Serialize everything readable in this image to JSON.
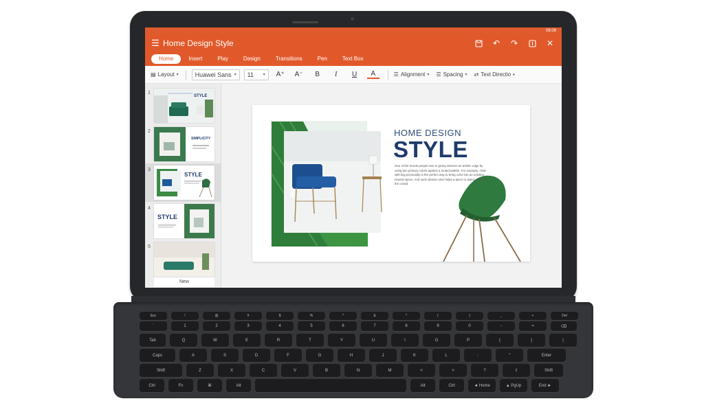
{
  "status": {
    "time": "08:08"
  },
  "app": {
    "title": "Home Design Style"
  },
  "tabs": [
    "Home",
    "Insert",
    "Play",
    "Design",
    "Transitions",
    "Pen",
    "Text Box"
  ],
  "toolbar": {
    "layout": "Layout",
    "font": "Huawei Sans",
    "size": "11",
    "grow_font": "A⁺",
    "shrink_font": "A⁻",
    "bold": "B",
    "italic": "I",
    "underline": "U",
    "font_color": "A",
    "alignment": "Alignment",
    "spacing": "Spacing",
    "text_direction": "Text Directio"
  },
  "thumbnails": [
    {
      "num": "1",
      "caption": "STYLE"
    },
    {
      "num": "2",
      "caption": "SIMPLICITY"
    },
    {
      "num": "3",
      "caption": "STYLE"
    },
    {
      "num": "4",
      "caption": "STYLE"
    },
    {
      "num": "5",
      "caption": ""
    }
  ],
  "new_label": "New",
  "slide": {
    "kicker": "HOME DESIGN",
    "title": "STYLE",
    "body": "One of the trends people love is giving interiors an artistic edge by using two primary colors against a muted palette. For example, chair with big personality is the perfect way to bring color into an existing neutral space. And such vibrant color helps a piece to stand out from the crowd."
  },
  "keyboard": {
    "fn_row": [
      "Esc",
      "!",
      "@",
      "#",
      "$",
      "%",
      "^",
      "&",
      "*",
      "(",
      ")",
      "_",
      "+",
      "Del"
    ],
    "num_row": [
      "`",
      "1",
      "2",
      "3",
      "4",
      "5",
      "6",
      "7",
      "8",
      "9",
      "0",
      "-",
      "=",
      "⌫"
    ],
    "row1": [
      "Tab",
      "Q",
      "W",
      "E",
      "R",
      "T",
      "Y",
      "U",
      "I",
      "O",
      "P",
      "{",
      "}",
      "|"
    ],
    "row2": [
      "Caps",
      "A",
      "S",
      "D",
      "F",
      "G",
      "H",
      "J",
      "K",
      "L",
      ":",
      "\"",
      "Enter"
    ],
    "row3": [
      "Shift",
      "Z",
      "X",
      "C",
      "V",
      "B",
      "N",
      "M",
      "<",
      ">",
      "?",
      "⇧",
      "Shift"
    ],
    "row4": [
      "Ctrl",
      "Fn",
      "⌘",
      "Alt",
      "",
      "Alt",
      "Ctrl",
      "◄ Home",
      "▲ PgUp",
      "End ►"
    ]
  }
}
